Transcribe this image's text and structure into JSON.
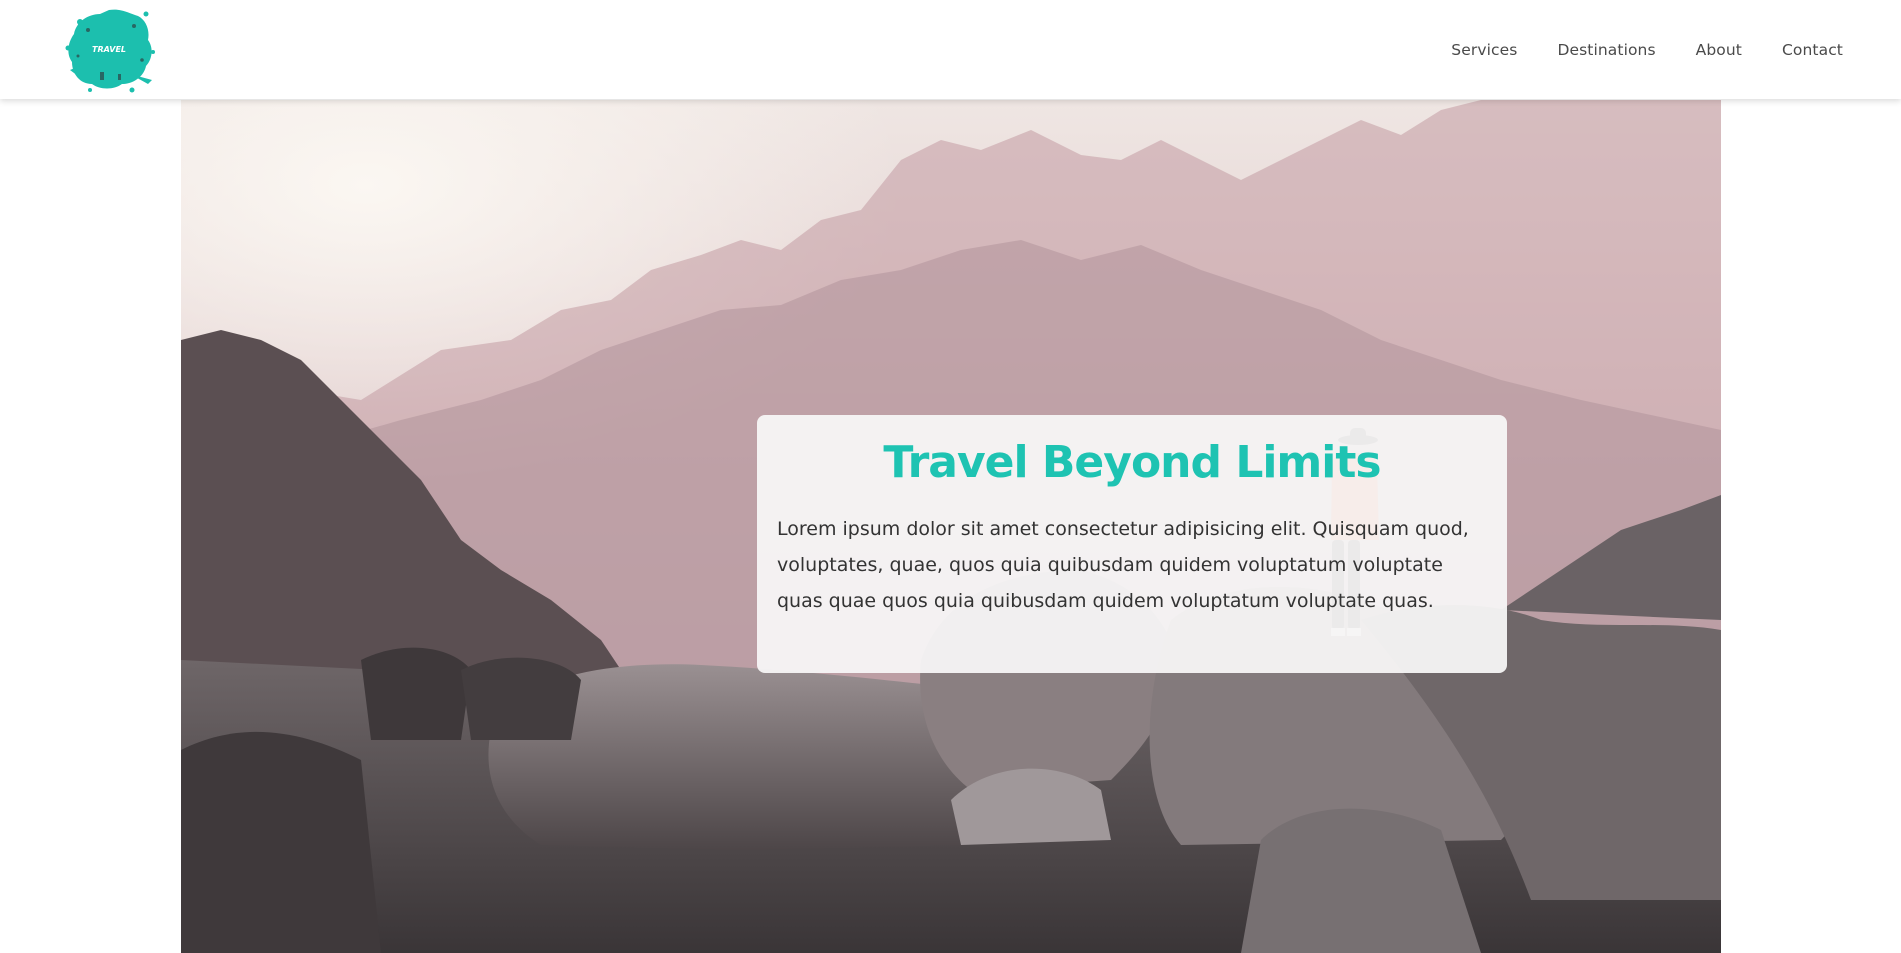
{
  "header": {
    "logo_text": "TRAVEL",
    "nav": [
      "Services",
      "Destinations",
      "About",
      "Contact"
    ]
  },
  "hero": {
    "title": "Travel Beyond Limits",
    "body": "Lorem ipsum dolor sit amet consectetur adipisicing elit. Quisquam quod, voluptates, quae, quos quia quibusdam quidem voluptatum voluptate quas quae quos quia quibusdam quidem voluptatum voluptate quas."
  },
  "colors": {
    "accent": "#1ec3b2",
    "nav_text": "#4a4a4a"
  }
}
